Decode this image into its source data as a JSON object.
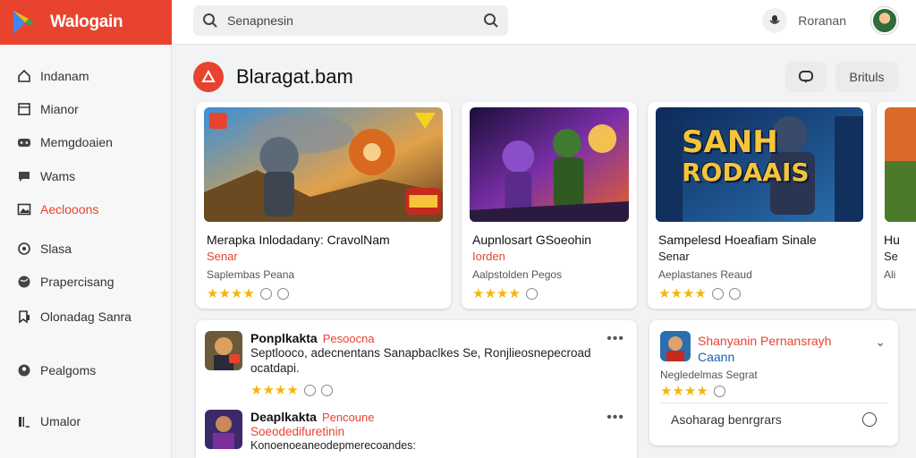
{
  "app": {
    "name": "Walogain"
  },
  "search": {
    "placeholder": "Senapnesin"
  },
  "user": {
    "name": "Roranan"
  },
  "sidebar": {
    "items": [
      {
        "label": "Indanam",
        "icon": "home-icon"
      },
      {
        "label": "Mianor",
        "icon": "square-icon"
      },
      {
        "label": "Memgdoaien",
        "icon": "game-icon"
      },
      {
        "label": "Wams",
        "icon": "chat-icon"
      },
      {
        "label": "Aeclooons",
        "icon": "image-icon",
        "active": true
      },
      {
        "label": "Slasa",
        "icon": "settings-icon"
      },
      {
        "label": "Prapercisang",
        "icon": "globe-icon"
      },
      {
        "label": "Olonadag Sanra",
        "icon": "bookmark-icon"
      },
      {
        "label": "Pealgoms",
        "icon": "person-icon"
      },
      {
        "label": "Umalor",
        "icon": "bars-icon"
      }
    ]
  },
  "section": {
    "title": "Blaragat.bam",
    "button_label": "Brituls"
  },
  "cards": [
    {
      "title": "Merapka Inlodadany: CravolNam",
      "sub": "Senar",
      "meta": "Saplembas Peana",
      "stars": "★★★★"
    },
    {
      "title": "Aupnlosart GSoeohin",
      "sub": "Iorden",
      "meta": "Aalpstolden Pegos",
      "stars": "★★★★"
    },
    {
      "title": "Sampelesd Hoeafiam Sinale",
      "sub": "Senar",
      "meta": "Aeplastanes Reaud",
      "stars": "★★★★"
    },
    {
      "title": "Hu",
      "sub": "Se",
      "meta": "Ali",
      "stars": ""
    }
  ],
  "card3_art": {
    "line1": "SANH",
    "line2": "RODAAIS"
  },
  "list": [
    {
      "title": "Ponplkakta",
      "tag": "Pesoocna",
      "line1": "Septlooco, adecnentans Sanapbaclkes Se, Ronjlieosnepecroad",
      "line2": "ocatdapi.",
      "stars": "★★★★"
    },
    {
      "title": "Deaplkakta",
      "tag": "Pencoune",
      "line1": "Soeodedifuretinin",
      "line2": "Konoenoeaneodepmerecoandes:",
      "stars": ""
    }
  ],
  "side_panel": {
    "title": "Shanyanin Pernansrayh",
    "sub": "Caann",
    "meta": "Negledelmas Segrat",
    "stars": "★★★★",
    "input_placeholder": "Asoharag benrgrars"
  },
  "colors": {
    "accent": "#e8432f",
    "star": "#f2b70e"
  }
}
